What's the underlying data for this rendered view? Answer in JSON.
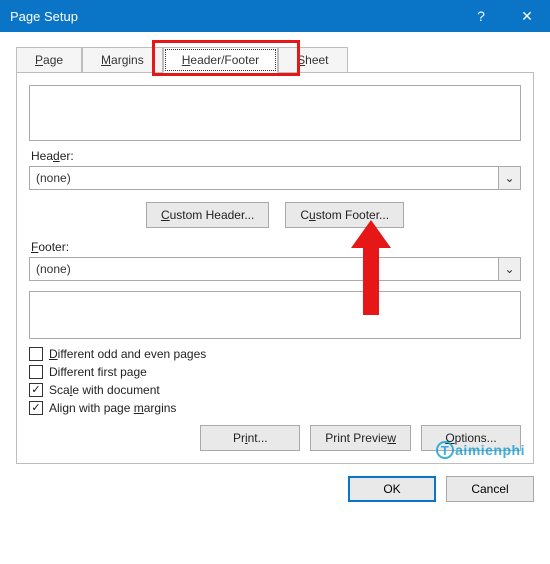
{
  "titlebar": {
    "title": "Page Setup",
    "help": "?",
    "close": "✕"
  },
  "tabs": {
    "page": {
      "label_pre": "",
      "label_u": "P",
      "label_post": "age"
    },
    "margins": {
      "label_pre": "",
      "label_u": "M",
      "label_post": "argins"
    },
    "hf": {
      "label_pre": "",
      "label_u": "H",
      "label_post": "eader/Footer"
    },
    "sheet": {
      "label_pre": "",
      "label_u": "S",
      "label_post": "heet"
    }
  },
  "header": {
    "label_pre": "Hea",
    "label_u": "d",
    "label_post": "er:",
    "value": "(none)"
  },
  "footer": {
    "label_pre": "",
    "label_u": "F",
    "label_post": "ooter:",
    "value": "(none)"
  },
  "buttons": {
    "custom_header": {
      "pre": "",
      "u": "C",
      "post": "ustom Header..."
    },
    "custom_footer": {
      "pre": "C",
      "u": "u",
      "post": "stom Footer..."
    },
    "print": {
      "pre": "Pr",
      "u": "i",
      "post": "nt..."
    },
    "preview": {
      "pre": "Print Previe",
      "u": "w",
      "post": ""
    },
    "options": {
      "pre": "",
      "u": "O",
      "post": "ptions..."
    },
    "ok": "OK",
    "cancel": "Cancel"
  },
  "checks": {
    "diff_odd": {
      "checked": false,
      "pre": "",
      "u": "D",
      "post": "ifferent odd and even pages"
    },
    "diff_first": {
      "checked": false,
      "pre": "Different first pa",
      "u": "g",
      "post": "e"
    },
    "scale": {
      "checked": true,
      "pre": "Sca",
      "u": "l",
      "post": "e with document"
    },
    "align": {
      "checked": true,
      "pre": "Align with page ",
      "u": "m",
      "post": "argins"
    }
  },
  "watermark": "aimienphi",
  "dropdown_icon": "⌄"
}
